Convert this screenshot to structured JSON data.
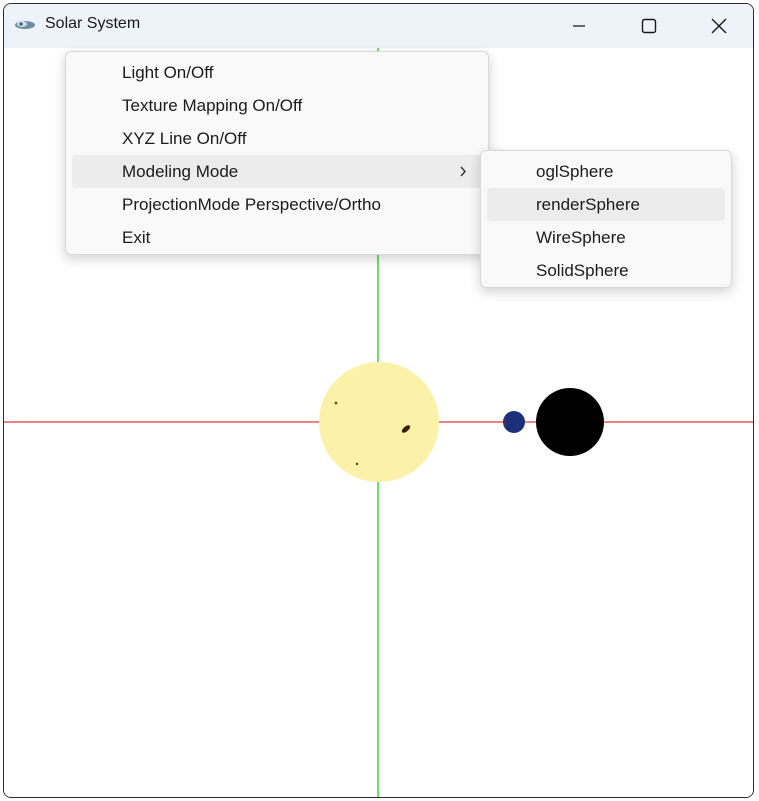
{
  "window": {
    "title": "Solar System",
    "icon": "app-icon",
    "controls": {
      "minimize": "minimize-icon",
      "maximize": "maximize-icon",
      "close": "close-icon"
    }
  },
  "context_menu": {
    "items": [
      {
        "label": "Light On/Off"
      },
      {
        "label": "Texture Mapping On/Off"
      },
      {
        "label": "XYZ Line On/Off"
      },
      {
        "label": "Modeling Mode",
        "submenu_indicator": ">"
      },
      {
        "label": "ProjectionMode Perspective/Ortho"
      },
      {
        "label": "Exit"
      }
    ],
    "highlighted_item": "Modeling Mode"
  },
  "submenu": {
    "items": [
      {
        "label": "oglSphere"
      },
      {
        "label": "renderSphere"
      },
      {
        "label": "WireSphere"
      },
      {
        "label": "SolidSphere"
      }
    ],
    "highlighted_item": "renderSphere"
  },
  "scene": {
    "axis_colors": {
      "x": "#e03b3b",
      "y": "#3bd43b"
    },
    "sun_color": "#fbf1a9",
    "planet_color": "#1c2f7a",
    "moon_color": "#000000"
  }
}
